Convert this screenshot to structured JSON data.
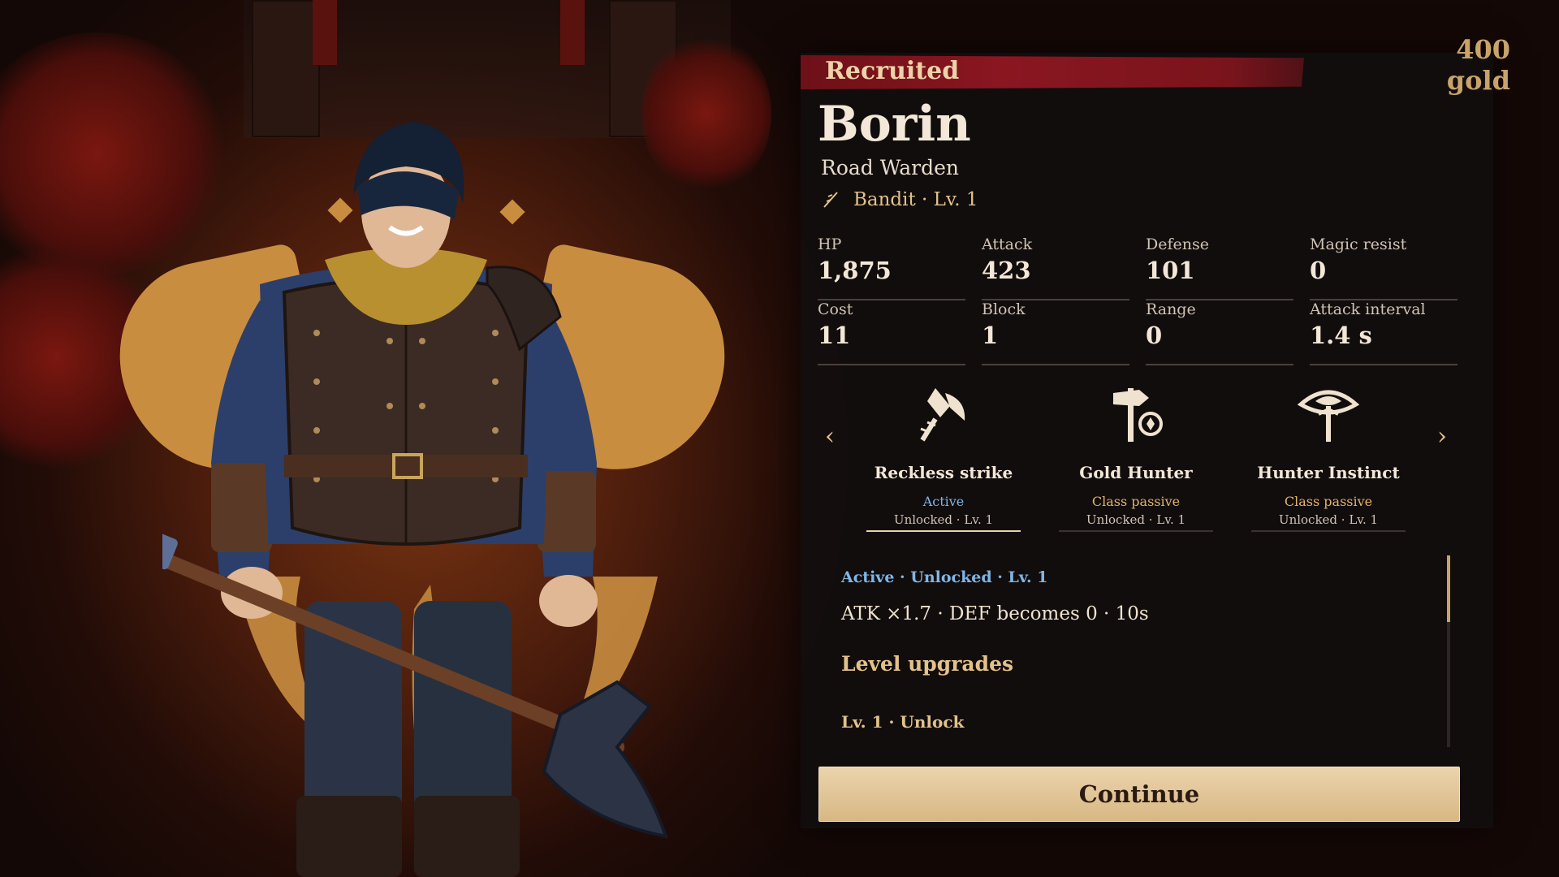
{
  "header": {
    "gold": "400 gold",
    "status_banner": "Recruited"
  },
  "unit": {
    "name": "Borin",
    "title": "Road Warden",
    "class_line": "Bandit · Lv. 1",
    "class_icon": "sword-slash-icon"
  },
  "stats": [
    {
      "label": "HP",
      "value": "1,875"
    },
    {
      "label": "Attack",
      "value": "423"
    },
    {
      "label": "Defense",
      "value": "101"
    },
    {
      "label": "Magic resist",
      "value": "0"
    },
    {
      "label": "Cost",
      "value": "11"
    },
    {
      "label": "Block",
      "value": "1"
    },
    {
      "label": "Range",
      "value": "0"
    },
    {
      "label": "Attack interval",
      "value": "1.4 s"
    }
  ],
  "skills": {
    "prev_arrow": "‹",
    "next_arrow": "›",
    "items": [
      {
        "name": "Reckless strike",
        "type": "Active",
        "status": "Unlocked · Lv. 1",
        "icon": "broken-axe-icon"
      },
      {
        "name": "Gold Hunter",
        "type": "Class passive",
        "status": "Unlocked · Lv. 1",
        "icon": "signpost-coin-icon"
      },
      {
        "name": "Hunter Instinct",
        "type": "Class passive",
        "status": "Unlocked · Lv. 1",
        "icon": "eye-post-icon"
      }
    ]
  },
  "detail": {
    "header": "Active · Unlocked · Lv. 1",
    "description": "ATK ×1.7 · DEF becomes 0 · 10s",
    "upgrades_title": "Level upgrades",
    "level_line": "Lv. 1 · Unlock"
  },
  "actions": {
    "continue_label": "Continue"
  },
  "colors": {
    "accent_gold": "#e2c28a",
    "active_blue": "#7fb6e6",
    "banner_red": "#7a141c",
    "button": "#e3c697"
  }
}
